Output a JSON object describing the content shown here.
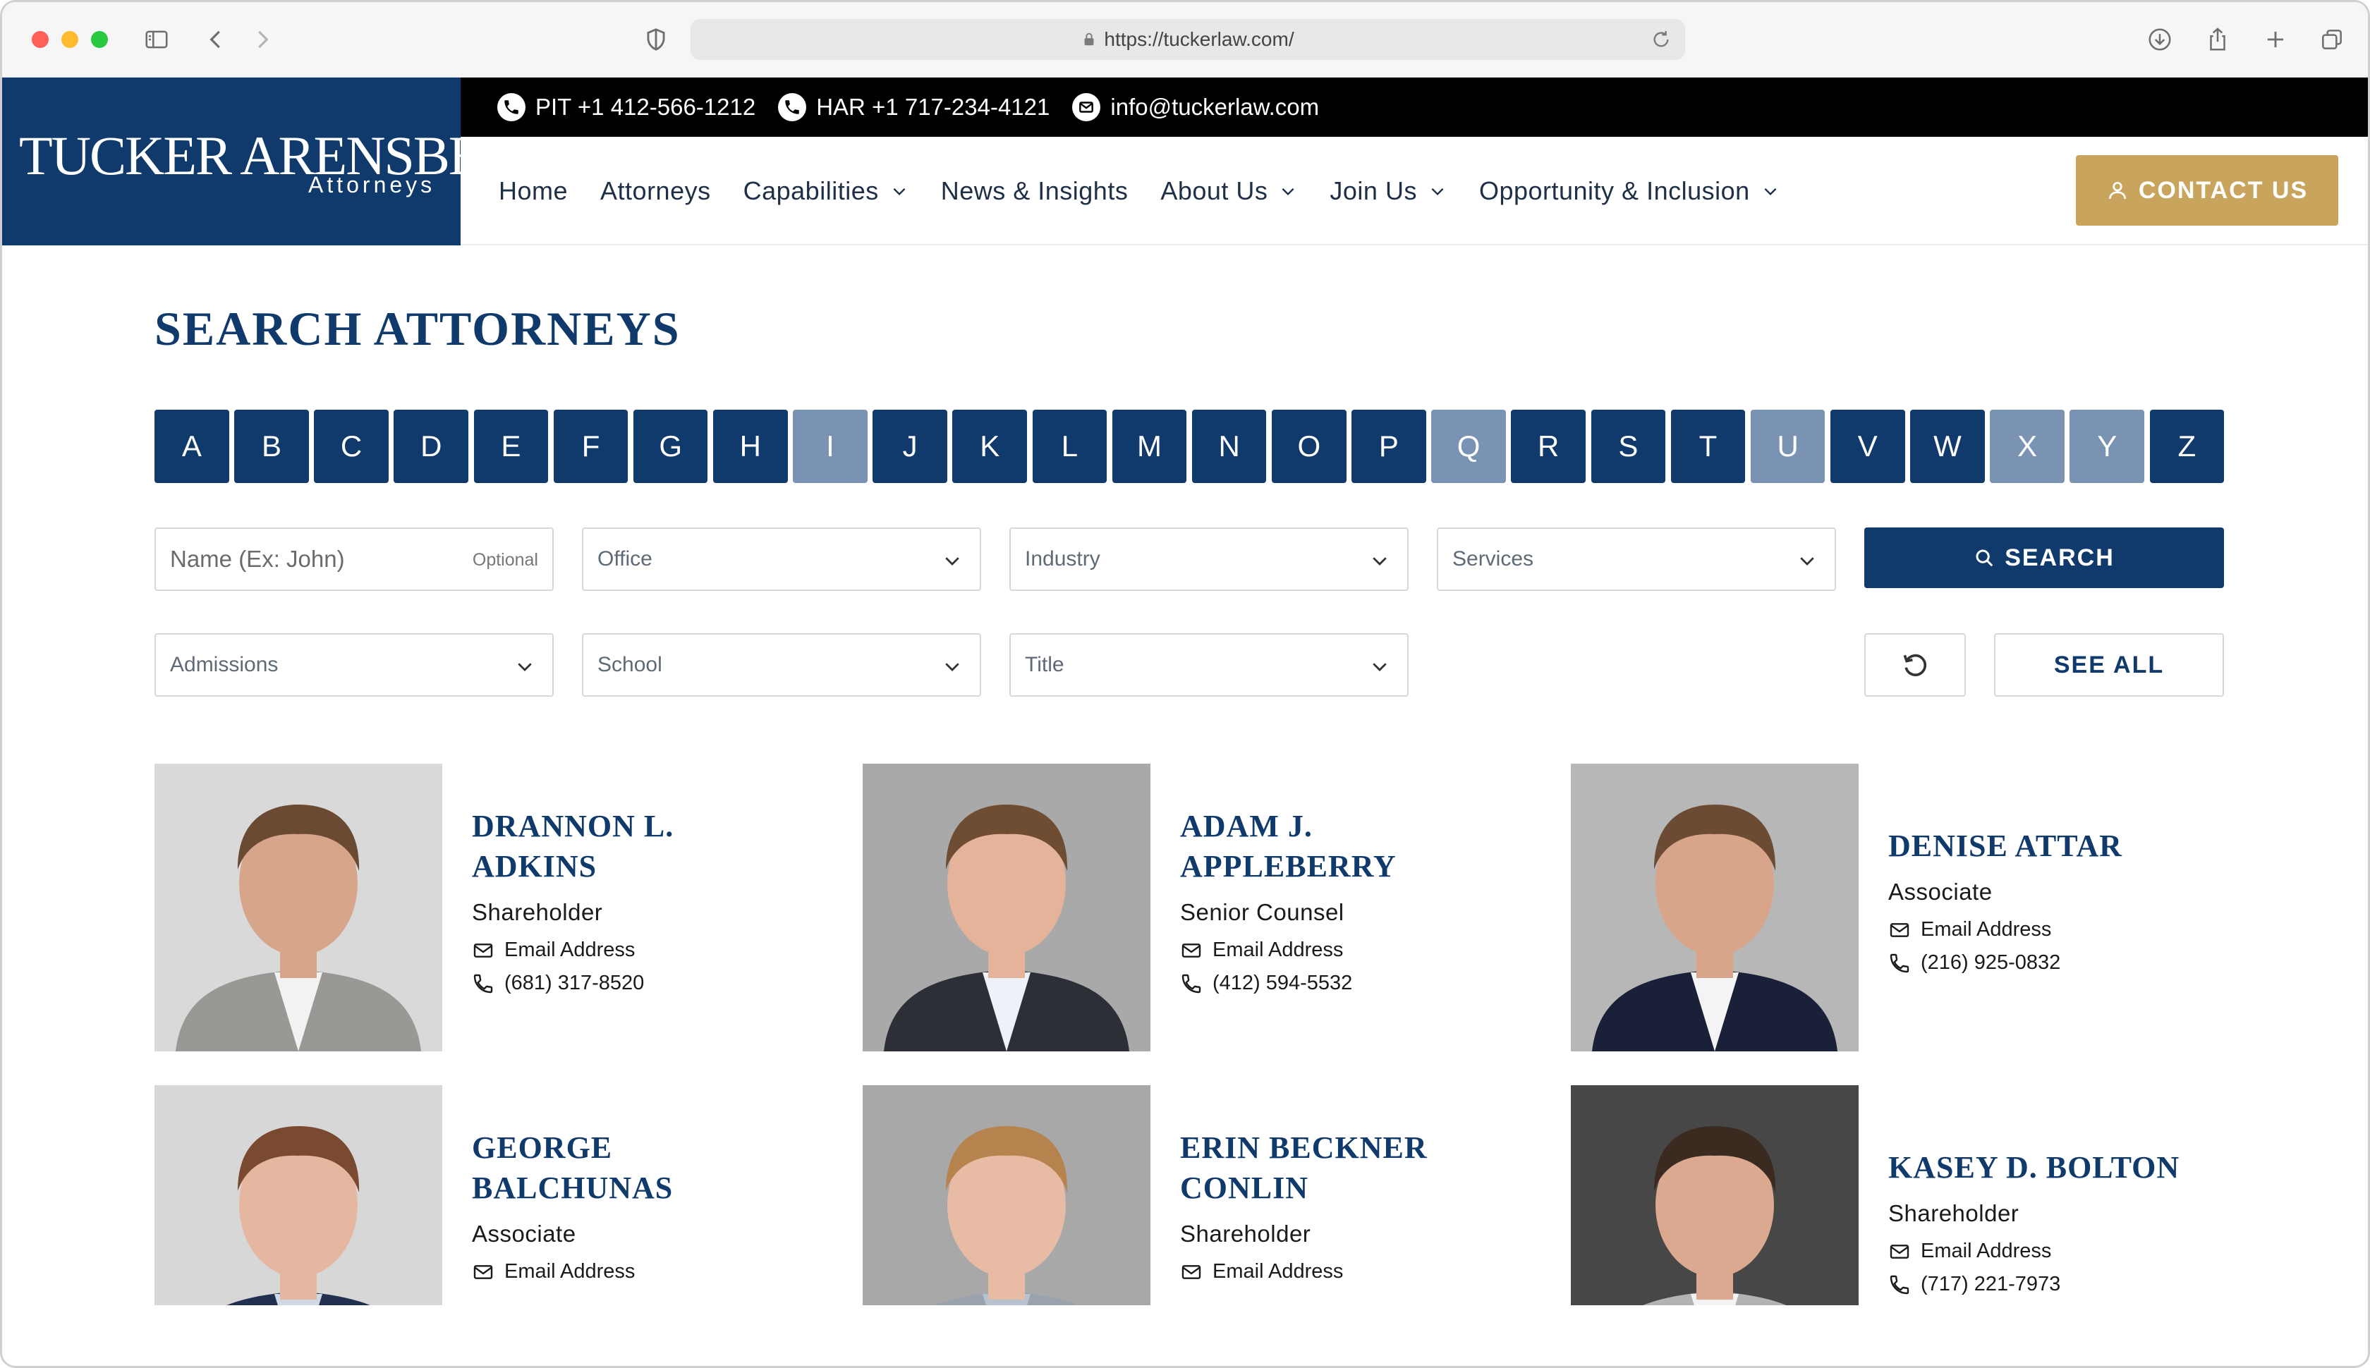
{
  "browser": {
    "url": "https://tuckerlaw.com/"
  },
  "site": {
    "logo": {
      "name": "TUCKER ARENSBERG",
      "tagline": "Attorneys"
    },
    "contact_bar": {
      "pit": "PIT +1 412-566-1212",
      "har": "HAR +1 717-234-4121",
      "email": "info@tuckerlaw.com"
    },
    "nav": {
      "home": "Home",
      "attorneys": "Attorneys",
      "capabilities": "Capabilities",
      "news": "News & Insights",
      "about": "About Us",
      "join": "Join Us",
      "opportunity": "Opportunity & Inclusion"
    },
    "contact_button": "CONTACT US"
  },
  "search": {
    "title": "SEARCH ATTORNEYS",
    "letters": [
      {
        "l": "A",
        "active": true
      },
      {
        "l": "B",
        "active": true
      },
      {
        "l": "C",
        "active": true
      },
      {
        "l": "D",
        "active": true
      },
      {
        "l": "E",
        "active": true
      },
      {
        "l": "F",
        "active": true
      },
      {
        "l": "G",
        "active": true
      },
      {
        "l": "H",
        "active": true
      },
      {
        "l": "I",
        "active": false
      },
      {
        "l": "J",
        "active": true
      },
      {
        "l": "K",
        "active": true
      },
      {
        "l": "L",
        "active": true
      },
      {
        "l": "M",
        "active": true
      },
      {
        "l": "N",
        "active": true
      },
      {
        "l": "O",
        "active": true
      },
      {
        "l": "P",
        "active": true
      },
      {
        "l": "Q",
        "active": false
      },
      {
        "l": "R",
        "active": true
      },
      {
        "l": "S",
        "active": true
      },
      {
        "l": "T",
        "active": true
      },
      {
        "l": "U",
        "active": false
      },
      {
        "l": "V",
        "active": true
      },
      {
        "l": "W",
        "active": true
      },
      {
        "l": "X",
        "active": false
      },
      {
        "l": "Y",
        "active": false
      },
      {
        "l": "Z",
        "active": true
      }
    ],
    "name_placeholder": "Name (Ex: John)",
    "name_optional": "Optional",
    "office": "Office",
    "industry": "Industry",
    "services": "Services",
    "admissions": "Admissions",
    "school": "School",
    "title_filter": "Title",
    "search_button": "SEARCH",
    "see_all_button": "SEE ALL"
  },
  "attorneys": [
    {
      "name_line1": "DRANNON L.",
      "name_line2": "ADKINS",
      "title": "Shareholder",
      "email_label": "Email Address",
      "phone": "(681) 317-8520"
    },
    {
      "name_line1": "ADAM J.",
      "name_line2": "APPLEBERRY",
      "title": "Senior Counsel",
      "email_label": "Email Address",
      "phone": "(412) 594-5532"
    },
    {
      "name_line1": "DENISE ATTAR",
      "name_line2": "",
      "title": "Associate",
      "email_label": "Email Address",
      "phone": "(216) 925-0832"
    },
    {
      "name_line1": "GEORGE",
      "name_line2": "BALCHUNAS",
      "title": "Associate",
      "email_label": "Email Address",
      "phone": ""
    },
    {
      "name_line1": "ERIN BECKNER",
      "name_line2": "CONLIN",
      "title": "Shareholder",
      "email_label": "Email Address",
      "phone": ""
    },
    {
      "name_line1": "KASEY D. BOLTON",
      "name_line2": "",
      "title": "Shareholder",
      "email_label": "Email Address",
      "phone": "(717) 221-7973"
    }
  ],
  "colors": {
    "navy": "#0f3a6b",
    "gold": "#c9a45c",
    "letter_disabled": "#7a93b3"
  }
}
